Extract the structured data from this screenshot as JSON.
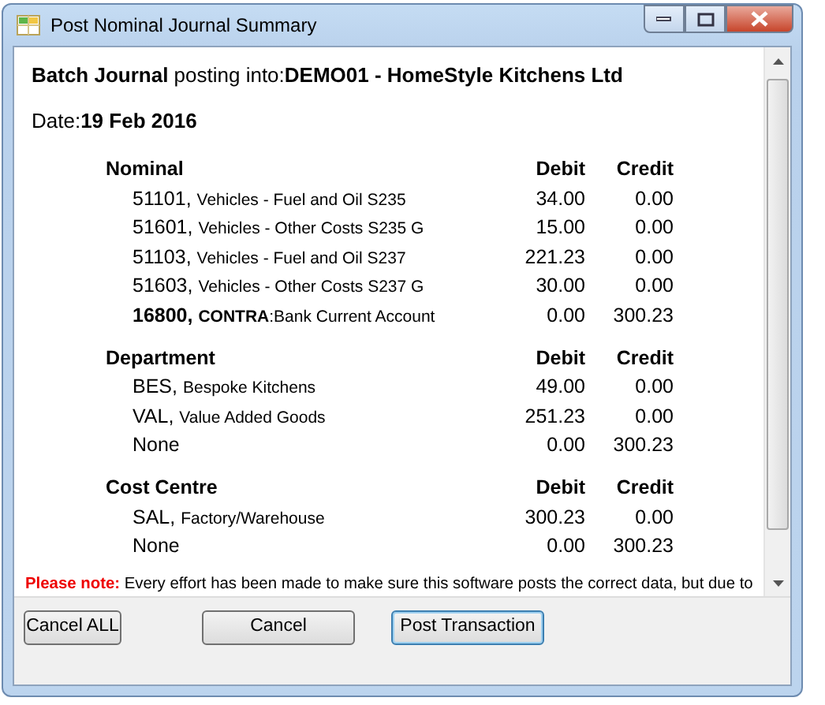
{
  "window": {
    "title": "Post Nominal Journal Summary"
  },
  "heading": "**Batch Journal** posting into:**DEMO01 - HomeStyle Kitchens Ltd**",
  "date": "Date:**19 Feb 2016**",
  "sections": [
    {
      "title": "Nominal",
      "debit_label": "Debit",
      "credit_label": "Credit",
      "rows": [
        {
          "code": "51101,",
          "description": "Vehicles - Fuel and Oil S235",
          "debit": "34.00",
          "credit": "0.00"
        },
        {
          "code": "51601,",
          "description": "Vehicles - Other Costs S235 G",
          "debit": "15.00",
          "credit": "0.00"
        },
        {
          "code": "51103,",
          "description": "Vehicles - Fuel and Oil S237",
          "debit": "221.23",
          "credit": "0.00"
        },
        {
          "code": "51603,",
          "description": "Vehicles - Other Costs S237 G",
          "debit": "30.00",
          "credit": "0.00"
        },
        {
          "code": "**16800,**",
          "description": "**CONTRA**:Bank Current Account",
          "debit": "0.00",
          "credit": "300.23"
        }
      ]
    },
    {
      "title": "Department",
      "debit_label": "Debit",
      "credit_label": "Credit",
      "rows": [
        {
          "code": "BES,",
          "description": "Bespoke Kitchens",
          "debit": "49.00",
          "credit": "0.00"
        },
        {
          "code": "VAL,",
          "description": "Value Added Goods",
          "debit": "251.23",
          "credit": "0.00"
        },
        {
          "code": "None",
          "debit": "0.00",
          "credit": "300.23"
        }
      ]
    },
    {
      "title": "Cost Centre",
      "debit_label": "Debit",
      "credit_label": "Credit",
      "rows": [
        {
          "code": "SAL,",
          "description": "Factory/Warehouse",
          "debit": "300.23",
          "credit": "0.00"
        },
        {
          "code": "None",
          "debit": "0.00",
          "credit": "300.23"
        }
      ]
    }
  ],
  "note": "**Please note:** Every effort has been made to make sure this software posts the correct data, but due to",
  "buttons": [
    {
      "label": "Cancel ALL",
      "default": false
    },
    {
      "label": "Cancel",
      "default": false
    },
    {
      "label": "Post Transaction",
      "default": true
    }
  ]
}
